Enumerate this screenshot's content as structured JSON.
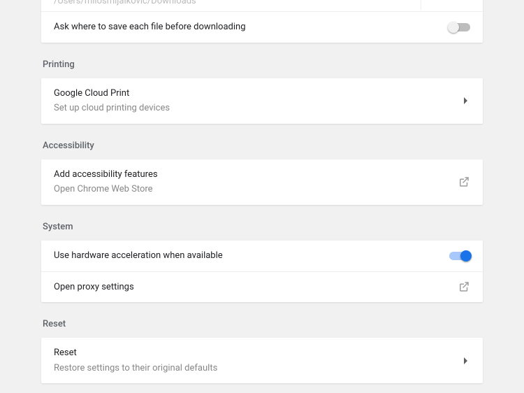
{
  "downloads": {
    "location_path": "/Users/milosmijalkovic/Downloads",
    "ask_label": "Ask where to save each file before downloading",
    "ask_value": false
  },
  "sections": {
    "printing": {
      "title": "Printing",
      "cloud_print": {
        "title": "Google Cloud Print",
        "subtitle": "Set up cloud printing devices"
      }
    },
    "accessibility": {
      "title": "Accessibility",
      "add_features": {
        "title": "Add accessibility features",
        "subtitle": "Open Chrome Web Store"
      }
    },
    "system": {
      "title": "System",
      "hw_accel": {
        "title": "Use hardware acceleration when available",
        "value": true
      },
      "proxy": {
        "title": "Open proxy settings"
      }
    },
    "reset": {
      "title": "Reset",
      "reset_row": {
        "title": "Reset",
        "subtitle": "Restore settings to their original defaults"
      }
    }
  }
}
